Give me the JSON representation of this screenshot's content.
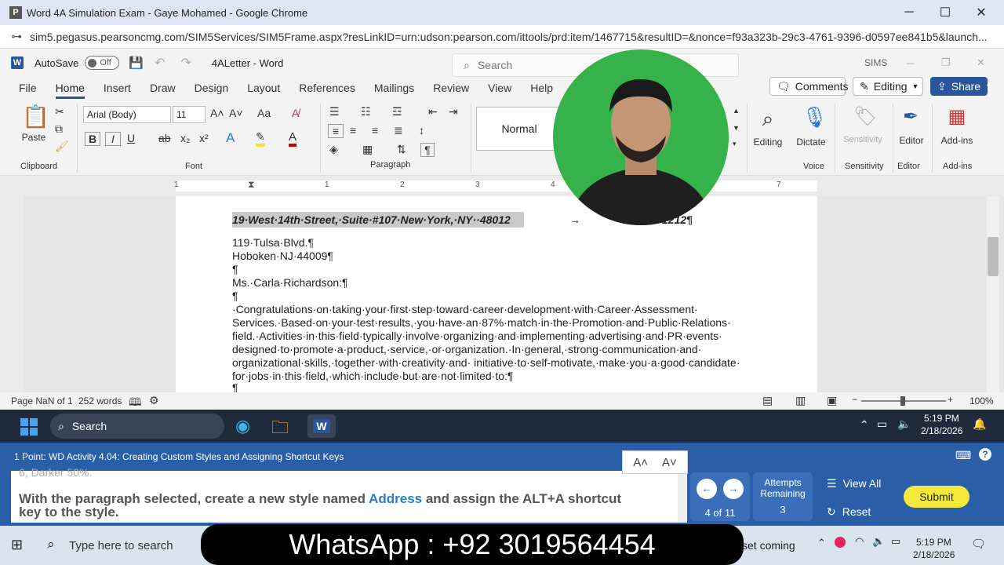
{
  "chrome": {
    "favicon": "P",
    "title": "Word 4A Simulation Exam - Gaye Mohamed - Google Chrome",
    "url": "sim5.pegasus.pearsoncmg.com/SIM5Services/SIM5Frame.aspx?resLinkID=urn:udson:pearson.com/ittools/prd:item/1467715&resultID=&nonce=f93a323b-29c3-4761-9396-d0597ee841b5&launch..."
  },
  "word": {
    "autosave_label": "AutoSave",
    "autosave_state": "Off",
    "doc_title": "4ALetter - Word",
    "search_placeholder": "Search",
    "sims_label": "SIMS"
  },
  "tabs": [
    "File",
    "Home",
    "Insert",
    "Draw",
    "Design",
    "Layout",
    "References",
    "Mailings",
    "Review",
    "View",
    "Help"
  ],
  "ribbon_right": {
    "comments": "Comments",
    "editing": "Editing",
    "share": "Share"
  },
  "ribbon": {
    "paste": "Paste",
    "clipboard": "Clipboard",
    "font_name": "Arial (Body)",
    "font_size": "11",
    "font": "Font",
    "paragraph": "Paragraph",
    "style_normal": "Normal",
    "editing": "Editing",
    "dictate": "Dictate",
    "voice": "Voice",
    "sensitivity": "Sensitivity",
    "editor": "Editor",
    "addins": "Add-ins",
    "group_sensitivity": "Sensitivity",
    "group_editor": "Editor",
    "group_addins": "Add-ins"
  },
  "ruler_numbers": [
    "1",
    "1",
    "2",
    "3",
    "4",
    "7"
  ],
  "document": {
    "line1": "19·West·14th·Street,·Suite·#107·New·York,·NY··48012",
    "line1_tail": "→",
    "line1_end": "1212¶",
    "lines": [
      "119·Tulsa·Blvd.¶",
      "Hoboken·NJ·44009¶",
      "¶",
      "Ms.·Carla·Richardson:¶",
      "¶",
      "·Congratulations·on·taking·your·first·step·toward·career·development·with·Career·Assessment·",
      "Services.·Based·on·your·test·results,·you·have·an·87%·match·in·the·Promotion·and·Public·Relations·",
      "field.·Activities·in·this·field·typically·involve·organizing·and·implementing·advertising·and·PR·events·",
      "designed·to·promote·a·product,·service,·or·organization.·In·general,·strong·communication·and·",
      "organizational·skills,·together·with·creativity·and· initiative·to·self-motivate,·make·you·a·good·candidate·",
      "for·jobs·in·this·field,·which·include·but·are·not·limited·to:¶",
      "¶"
    ]
  },
  "status": {
    "page": "Page NaN of 1",
    "words": "252 words",
    "zoom": "100%"
  },
  "taskbar1": {
    "search": "Search",
    "time": "5:19 PM",
    "date": "2/18/2026"
  },
  "sim": {
    "header": "1 Point: WD Activity 4.04: Creating Custom Styles and Assigning Shortcut Keys",
    "cut_text": "6, Darker 50%.",
    "instruction_a": "With the paragraph selected, create a new style named ",
    "instruction_b": "Address",
    "instruction_c": " and assign the ALT+A shortcut",
    "instruction_d": "key to the style.",
    "progress": "4 of 11",
    "attempts_label_1": "Attempts",
    "attempts_label_2": "Remaining",
    "attempts": "3",
    "view_all": "View All",
    "reset": "Reset",
    "submit": "Submit"
  },
  "taskbar2": {
    "search": "Type here to search",
    "notice": "set coming",
    "time": "5:19 PM",
    "date": "2/18/2026"
  },
  "overlay": {
    "whatsapp": "WhatsApp : +92 3019564454"
  },
  "colors": {
    "word_blue": "#2b579a",
    "sim_blue": "#2a5fa8",
    "submit_yellow": "#f7e93b",
    "webcam_green": "#36b24a"
  }
}
